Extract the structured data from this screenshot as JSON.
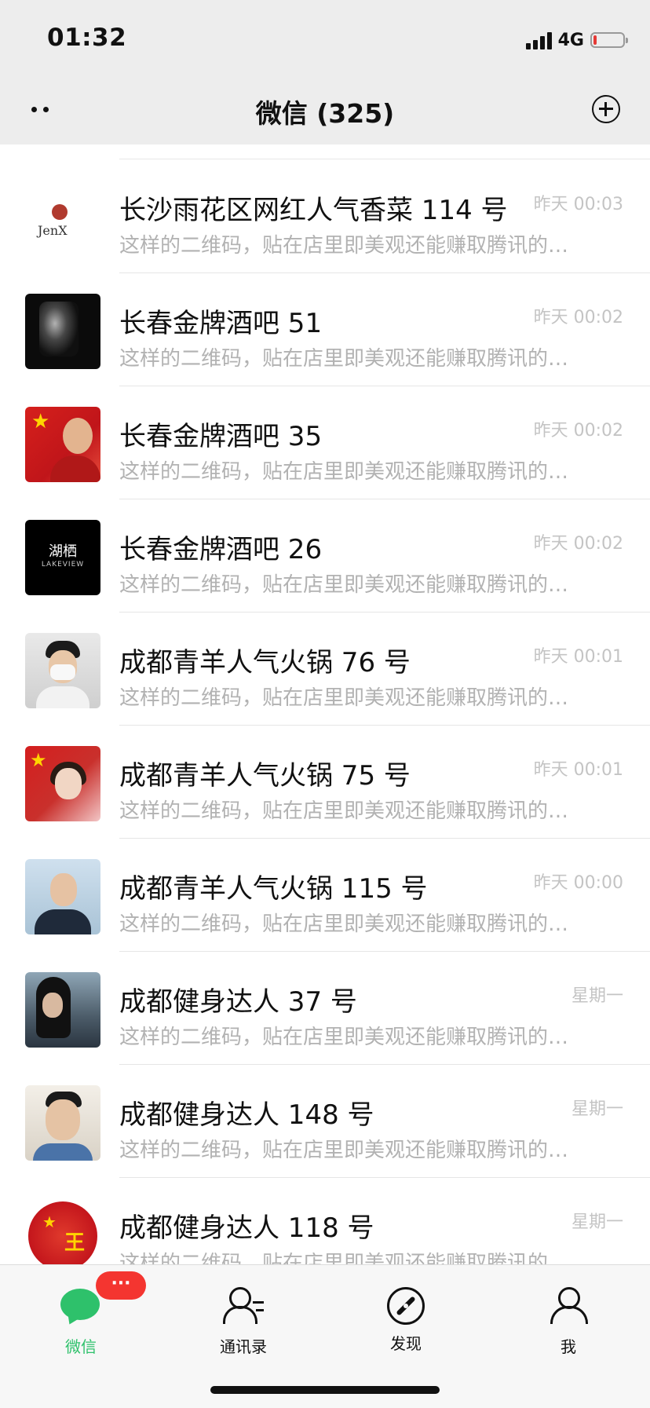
{
  "status_bar": {
    "time": "01:32",
    "network": "4G"
  },
  "nav": {
    "title": "微信 (325)"
  },
  "chats": [
    {
      "name": "长沙雨花区网红人气香菜 114 号",
      "message": "这样的二维码，贴在店里即美观还能赚取腾讯的…",
      "time": "昨天 00:03",
      "avatar": "jenx-logo",
      "avatar_text": "JenX"
    },
    {
      "name": "长春金牌酒吧 51",
      "message": "这样的二维码，贴在店里即美观还能赚取腾讯的…",
      "time": "昨天 00:02",
      "avatar": "bar-sign"
    },
    {
      "name": "长春金牌酒吧 35",
      "message": "这样的二维码，贴在店里即美观还能赚取腾讯的…",
      "time": "昨天 00:02",
      "avatar": "flag-portrait"
    },
    {
      "name": "长春金牌酒吧 26",
      "message": "这样的二维码，贴在店里即美观还能赚取腾讯的…",
      "time": "昨天 00:02",
      "avatar": "lakeview-logo",
      "avatar_text": "湖栖",
      "avatar_subtext": "LAKEVIEW"
    },
    {
      "name": "成都青羊人气火锅 76 号",
      "message": "这样的二维码，贴在店里即美观还能赚取腾讯的…",
      "time": "昨天 00:01",
      "avatar": "mask-portrait"
    },
    {
      "name": "成都青羊人气火锅 75 号",
      "message": "这样的二维码，贴在店里即美观还能赚取腾讯的…",
      "time": "昨天 00:01",
      "avatar": "flag-girl-portrait"
    },
    {
      "name": "成都青羊人气火锅 115 号",
      "message": "这样的二维码，贴在店里即美观还能赚取腾讯的…",
      "time": "昨天 00:00",
      "avatar": "man-portrait"
    },
    {
      "name": "成都健身达人 37 号",
      "message": "这样的二维码，贴在店里即美观还能赚取腾讯的…",
      "time": "星期一",
      "avatar": "sea-portrait"
    },
    {
      "name": "成都健身达人 148 号",
      "message": "这样的二维码，贴在店里即美观还能赚取腾讯的…",
      "time": "星期一",
      "avatar": "boy-portrait"
    },
    {
      "name": "成都健身达人 118 号",
      "message": "这样的二维码，贴在店里即美观还能赚取腾讯的…",
      "time": "星期一",
      "avatar": "red-badge",
      "avatar_text": "王"
    }
  ],
  "tabbar": {
    "tabs": [
      {
        "label": "微信",
        "icon": "chat-bubble-icon",
        "active": true
      },
      {
        "label": "通讯录",
        "icon": "contacts-icon",
        "active": false
      },
      {
        "label": "发现",
        "icon": "compass-icon",
        "active": false
      },
      {
        "label": "我",
        "icon": "person-icon",
        "active": false
      }
    ],
    "badge": "···"
  },
  "colors": {
    "accent": "#2ec16b",
    "badge": "#f43530",
    "header_bg": "#ededed",
    "muted_text": "#b2b2b2"
  }
}
